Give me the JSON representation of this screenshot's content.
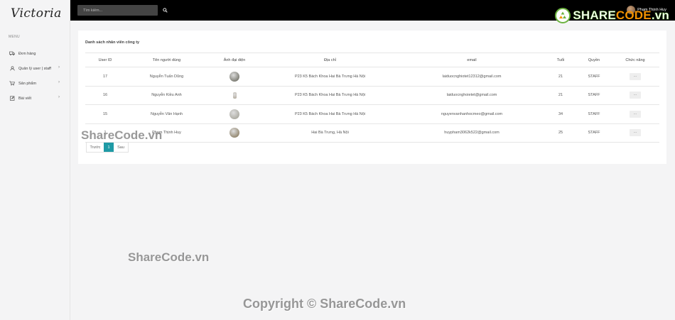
{
  "brand": "Victoria",
  "sidebar": {
    "menu_title": "MENU",
    "items": [
      {
        "label": "Đơn hàng",
        "icon": "truck-icon",
        "has_sub": false
      },
      {
        "label": "Quản lý user | staff",
        "icon": "user-icon",
        "has_sub": true
      },
      {
        "label": "Sản phẩm",
        "icon": "cart-icon",
        "has_sub": true
      },
      {
        "label": "Bài viết",
        "icon": "edit-icon",
        "has_sub": true
      }
    ]
  },
  "topbar": {
    "search_placeholder": "Tìm kiếm...",
    "user_name": "Phạm Thịnh Huy"
  },
  "card": {
    "title": "Danh sách nhân viên công ty",
    "columns": [
      "User ID",
      "Tên người dùng",
      "Ảnh đại diện",
      "Địa chỉ",
      "email",
      "Tuổi",
      "Quyền",
      "Chức năng"
    ],
    "rows": [
      {
        "id": "17",
        "name": "Nguyễn Tuấn Dũng",
        "avatar_color": "#5a5a4e",
        "address": "P23 K5 Bách Khoa Hai Bà Trưng Hà Nội",
        "email": "laiduocnghiotet12312@gmail.com",
        "age": "21",
        "role": "STAFF",
        "action": "···"
      },
      {
        "id": "16",
        "name": "Nguyễn Kiều Anh",
        "avatar_color": "#b0a89a",
        "address": "P23 K5 Bách Khoa Hai Bà Trưng Hà Nội",
        "email": "laiduocnghoietet@gmail.com",
        "age": "21",
        "role": "STAFF",
        "action": "···"
      },
      {
        "id": "15",
        "name": "Nguyễn Văn Hạnh",
        "avatar_color": "#9c9a8e",
        "address": "P23 K5 Bách Khoa Hai Bà Trưng Hà Nội",
        "email": "nguyenvanhanhocmeo@gmail.com",
        "age": "34",
        "role": "STAFF",
        "action": "···"
      },
      {
        "id": "1",
        "name": "Phạm Thịnh Huy",
        "avatar_color": "#7a6a4a",
        "address": "Hai Bà Trưng, Hà Nội",
        "email": "huypham3062k522@gmail.com",
        "age": "25",
        "role": "STAFF",
        "action": "···"
      }
    ]
  },
  "pagination": {
    "prev": "Trước",
    "current": "1",
    "next": "Sau"
  },
  "watermarks": [
    "ShareCode.vn",
    "ShareCode.vn",
    "Copyright © ShareCode.vn"
  ],
  "logo": {
    "part1": "SHARE",
    "part2": "CODE",
    "part3": ".vn"
  },
  "colors": {
    "accent": "#1e9aa5",
    "topbar": "#000000",
    "logo_green": "#6cb33f",
    "logo_orange": "#f29100"
  }
}
